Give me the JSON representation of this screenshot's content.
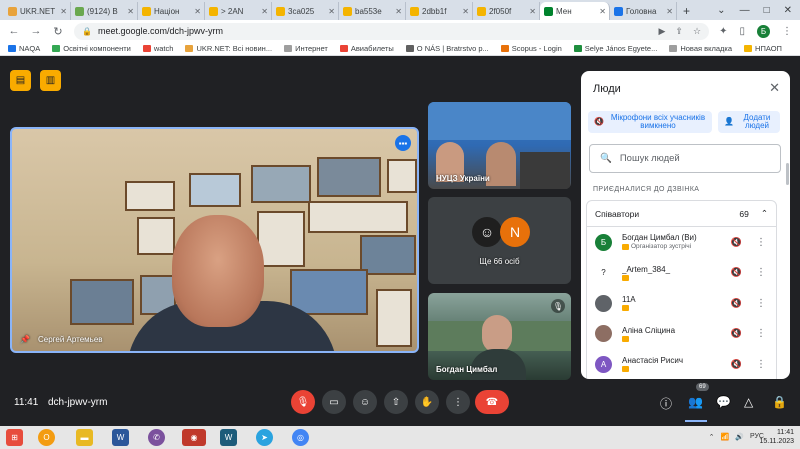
{
  "browser": {
    "tabs": [
      {
        "label": "UKR.NET",
        "color": "#e8a33c"
      },
      {
        "label": "(9124) В",
        "color": "#6aa84f"
      },
      {
        "label": "Націон",
        "color": "#f4b400"
      },
      {
        "label": "> 2AN",
        "color": "#f4b400"
      },
      {
        "label": "3ca025",
        "color": "#f4b400"
      },
      {
        "label": "ba553e",
        "color": "#f4b400"
      },
      {
        "label": "2dbb1f",
        "color": "#f4b400"
      },
      {
        "label": "2f050f",
        "color": "#f4b400"
      },
      {
        "label": "Мен",
        "color": "#00832d",
        "active": true
      },
      {
        "label": "Головна",
        "color": "#1a73e8"
      }
    ],
    "url": "meet.google.com/dch-jpwv-yrm",
    "profile_initial": "Б",
    "bookmarks": [
      {
        "label": "NAQA",
        "color": "#1a73e8"
      },
      {
        "label": "Освітні компоненти",
        "color": "#34a853"
      },
      {
        "label": "watch",
        "color": "#ea4335"
      },
      {
        "label": "UKR.NET: Всі новин...",
        "color": "#e8a33c"
      },
      {
        "label": "Интернет",
        "color": "#9e9e9e"
      },
      {
        "label": "Авиабилеты",
        "color": "#ea4335"
      },
      {
        "label": "O NÁS | Bratrstvo p...",
        "color": "#616161"
      },
      {
        "label": "Scopus - Login",
        "color": "#e8710a"
      },
      {
        "label": "Selye János Egyete...",
        "color": "#1e8e3e"
      },
      {
        "label": "Новая вкладка",
        "color": "#9e9e9e"
      },
      {
        "label": "НПАОП",
        "color": "#f4b400"
      }
    ]
  },
  "meet": {
    "main_speaker": "Сергей Артемьев",
    "tiles": [
      {
        "label": "НУЦЗ України"
      },
      {
        "label": "Ще 66 осіб",
        "avatar_letter": "N"
      },
      {
        "label": "Богдан Цимбал"
      }
    ],
    "time": "11:41",
    "meeting_code": "dch-jpwv-yrm",
    "people_count_badge": "69"
  },
  "people_panel": {
    "title": "Люди",
    "mute_all_label": "Мікрофони всіх учасників вимкнено",
    "add_people_label": "Додати людей",
    "search_placeholder": "Пошук людей",
    "section_label": "ПРИЄДНАЛИСЯ ДО ДЗВІНКА",
    "group_name": "Співавтори",
    "group_count": "69",
    "participants": [
      {
        "name": "Богдан Цимбал (Ви)",
        "sub": "Організатор зустрічі",
        "initial": "Б",
        "color": "#188038"
      },
      {
        "name": "_Artem_384_",
        "sub": "",
        "initial": "?",
        "color": "#ffffff"
      },
      {
        "name": "11А",
        "sub": "",
        "initial": "",
        "color": "#5f6368"
      },
      {
        "name": "Аліна Сліцина",
        "sub": "",
        "initial": "",
        "color": "#8d6e63"
      },
      {
        "name": "Анастасія Рисич",
        "sub": "",
        "initial": "А",
        "color": "#7e57c2"
      }
    ]
  },
  "taskbar": {
    "lang": "РУС",
    "time": "11:41",
    "date": "15.11.2023"
  }
}
